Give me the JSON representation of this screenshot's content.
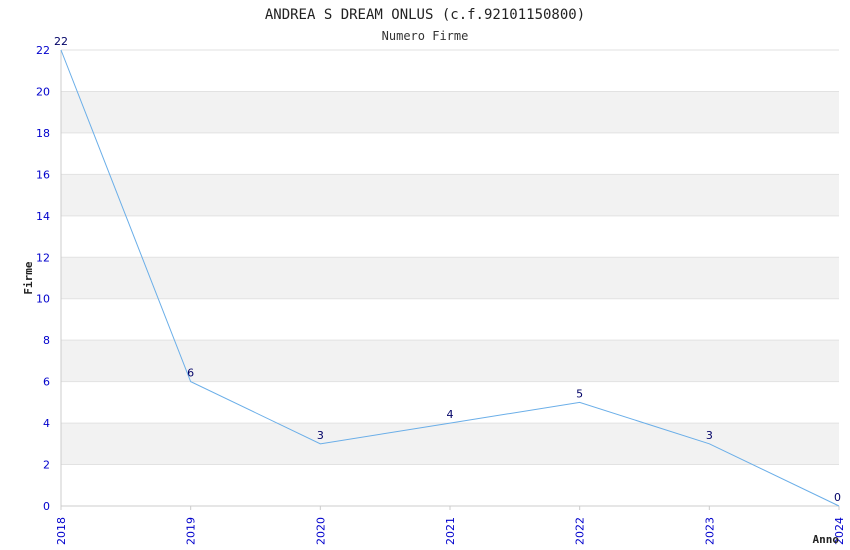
{
  "chart_data": {
    "type": "line",
    "title": "ANDREA S DREAM ONLUS (c.f.92101150800)",
    "subtitle": "Numero Firme",
    "xlabel": "Anno",
    "ylabel": "Firme",
    "categories": [
      "2018",
      "2019",
      "2020",
      "2021",
      "2022",
      "2023",
      "2024"
    ],
    "values": [
      22,
      6,
      3,
      4,
      5,
      3,
      0
    ],
    "ylim": [
      0,
      22
    ],
    "yticks": [
      "0",
      "2",
      "4",
      "6",
      "8",
      "10",
      "12",
      "14",
      "16",
      "18",
      "20",
      "22"
    ],
    "grid": "horizontal alternating bands",
    "legend": "none"
  },
  "colors": {
    "line": "#6aaee8",
    "band": "#f2f2f2",
    "tick_text": "#0000cc",
    "data_label": "#000066",
    "axis": "#cccccc"
  }
}
